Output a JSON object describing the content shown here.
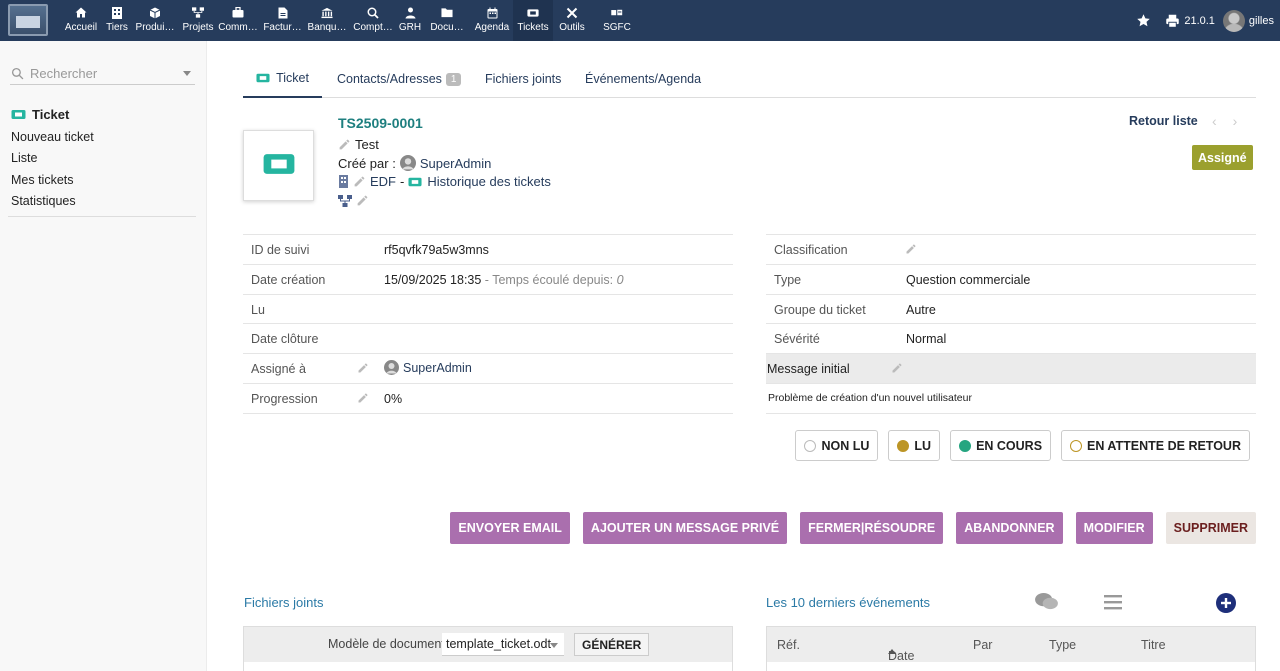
{
  "topnav": {
    "items": [
      {
        "label": "Accueil",
        "icon": "home-icon"
      },
      {
        "label": "Tiers",
        "icon": "building-icon"
      },
      {
        "label": "Produi…",
        "icon": "cube-icon"
      },
      {
        "label": "Projets",
        "icon": "sitemap-icon"
      },
      {
        "label": "Comm…",
        "icon": "briefcase-icon"
      },
      {
        "label": "Factur…",
        "icon": "invoice-icon"
      },
      {
        "label": "Banqu…",
        "icon": "bank-icon"
      },
      {
        "label": "Compt…",
        "icon": "search-dollar-icon"
      },
      {
        "label": "GRH",
        "icon": "user-icon"
      },
      {
        "label": "Docu…",
        "icon": "folder-icon"
      },
      {
        "label": "Agenda",
        "icon": "calendar-icon"
      },
      {
        "label": "Tickets",
        "icon": "ticket-icon",
        "active": true
      },
      {
        "label": "Outils",
        "icon": "tools-icon"
      },
      {
        "label": "SGFC",
        "icon": "documents-icon"
      }
    ],
    "version": "21.0.1",
    "username": "gilles",
    "bg_color": "#263c5c"
  },
  "sidebar": {
    "search_placeholder": "Rechercher",
    "title": "Ticket",
    "links": [
      "Nouveau ticket",
      "Liste",
      "Mes tickets",
      "Statistiques"
    ]
  },
  "tabs": [
    {
      "label": "Ticket",
      "active": true
    },
    {
      "label": "Contacts/Adresses",
      "badge": "1"
    },
    {
      "label": "Fichiers joints"
    },
    {
      "label": "Événements/Agenda"
    }
  ],
  "header": {
    "ref": "TS2509-0001",
    "subject": "Test",
    "created_by_label": "Créé par :",
    "created_by": "SuperAdmin",
    "company": "EDF",
    "separator": "-",
    "project": "Historique des tickets",
    "back_label": "Retour liste",
    "status": "Assigné",
    "status_color": "#9ba02e"
  },
  "fields_left": [
    {
      "label": "ID de suivi",
      "value": "rf5qvfk79a5w3mns"
    },
    {
      "label": "Date création",
      "value": "15/09/2025 18:35",
      "extra_label": " - Temps écoulé depuis: ",
      "extra_value": "0"
    },
    {
      "label": "Lu",
      "value": ""
    },
    {
      "label": "Date clôture",
      "value": ""
    },
    {
      "label": "Assigné à",
      "value": "SuperAdmin"
    },
    {
      "label": "Progression",
      "value": "0%"
    }
  ],
  "fields_right": [
    {
      "label": "Classification",
      "value": ""
    },
    {
      "label": "Type",
      "value": "Question commerciale"
    },
    {
      "label": "Groupe du ticket",
      "value": "Autre"
    },
    {
      "label": "Sévérité",
      "value": "Normal"
    }
  ],
  "initial_message": {
    "label": "Message initial",
    "text": "Problème de création d'un nouvel utilisateur"
  },
  "status_buttons": [
    {
      "label": "NON LU",
      "dot_color": "#ffffff",
      "dot_border": "#bbbbbb"
    },
    {
      "label": "LU",
      "dot_color": "#bc9526",
      "dot_border": "#bc9526"
    },
    {
      "label": "EN COURS",
      "dot_color": "#25a580",
      "dot_border": "#25a580"
    },
    {
      "label": "EN ATTENTE DE RETOUR",
      "dot_color": "#ffffff",
      "dot_border": "#bc9526"
    }
  ],
  "actions": [
    "ENVOYER EMAIL",
    "AJOUTER UN MESSAGE PRIVÉ",
    "FERMER|RÉSOUDRE",
    "ABANDONNER",
    "MODIFIER",
    "SUPPRIMER"
  ],
  "files_section": {
    "title": "Fichiers joints",
    "model_label": "Modèle de document",
    "model_value": "template_ticket.odt",
    "generate_label": "GÉNÉRER"
  },
  "events_section": {
    "title": "Les 10 derniers événements",
    "columns": [
      "Réf.",
      "Date",
      "Par",
      "Type",
      "Titre"
    ]
  }
}
